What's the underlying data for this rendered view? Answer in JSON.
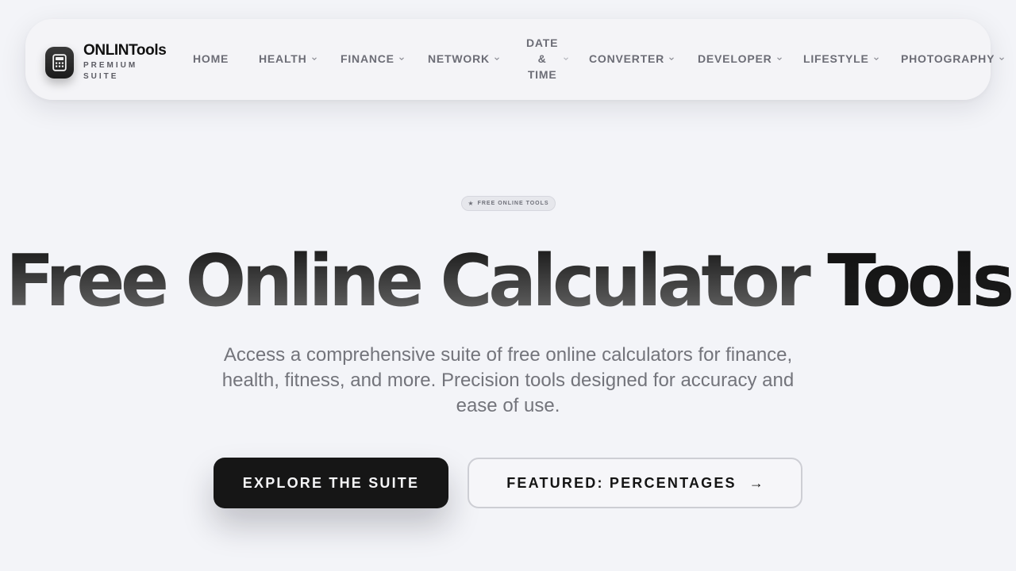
{
  "brand": {
    "name": "ONLINTools",
    "subtitle": "PREMIUM SUITE",
    "logo_icon": "calculator-icon"
  },
  "nav": {
    "home": "HOME",
    "health": "HEALTH",
    "finance": "FINANCE",
    "network": "NETWORK",
    "datetime_line1": "DATE",
    "datetime_line2": "&",
    "datetime_line3": "TIME",
    "converter": "CONVERTER",
    "developer": "DEVELOPER",
    "lifestyle": "LIFESTYLE",
    "photography": "PHOTOGRAPHY",
    "dropdown_icon": "chevron-down-icon"
  },
  "hero": {
    "badge": "FREE ONLINE TOOLS",
    "badge_icon": "star-icon",
    "title_main": "Free Online Calculator ",
    "title_accent": "Tools",
    "description": "Access a comprehensive suite of free online calculators for finance, health, fitness, and more. Precision tools designed for accuracy and ease of use.",
    "primary_cta": "EXPLORE THE SUITE",
    "secondary_cta": "FEATURED: PERCENTAGES",
    "secondary_arrow": "→"
  },
  "colors": {
    "background": "#f3f4f8",
    "primary_button": "#161616",
    "nav_text": "#6c6d76",
    "muted_text": "#73747b"
  }
}
